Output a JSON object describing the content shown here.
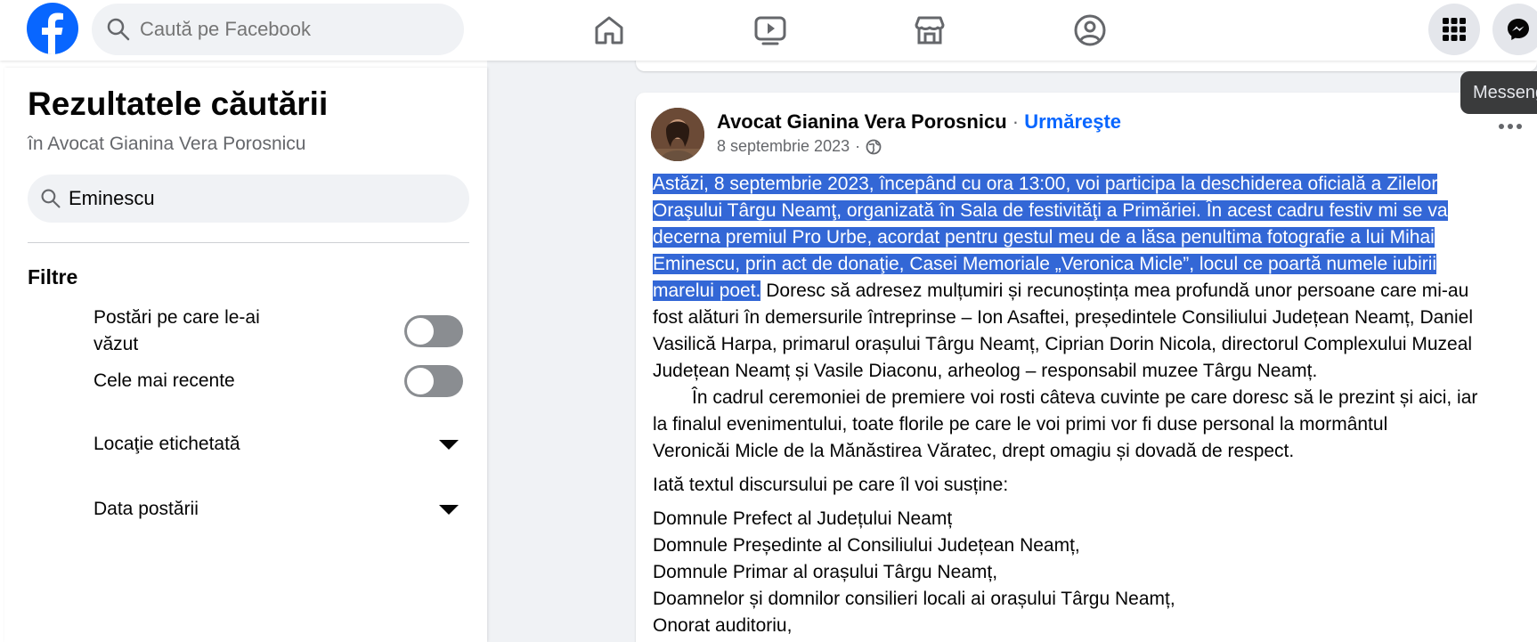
{
  "topbar": {
    "search_placeholder": "Caută pe Facebook",
    "nav": [
      "home-icon",
      "video-icon",
      "marketplace-icon",
      "groups-icon"
    ],
    "tooltip": "Messenger"
  },
  "sidebar": {
    "title": "Rezultatele căutării",
    "subtitle": "în Avocat Gianina Vera Porosnicu",
    "search_value": "Eminescu",
    "filters_heading": "Filtre",
    "filters": {
      "seen_line1": "Postări pe care le-ai",
      "seen_line2": "văzut",
      "recent": "Cele mai recente",
      "location": "Locaţie etichetată",
      "date": "Data postării"
    }
  },
  "post": {
    "author": "Avocat Gianina Vera Porosnicu",
    "separator": " · ",
    "follow_label": "Urmăreşte",
    "date": "8 septembrie 2023",
    "date_separator": "·",
    "lines": {
      "l1": "Astăzi, 8 septembrie 2023, începând cu ora 13:00, voi participa la deschiderea oficială a Zilelor",
      "l2": "Oraşului Târgu Neamţ, organizată în Sala de festivităţi a Primăriei. În acest cadru festiv mi se va",
      "l3": "decerna premiul Pro Urbe, acordat pentru gestul meu de a lăsa penultima fotografie a lui Mihai",
      "l4": "Eminescu, prin act de donaţie, Casei Memoriale „Veronica Micle”, locul ce poartă numele iubirii",
      "l5a": "marelui poet.",
      "l5b": " Doresc să adresez mulțumiri și recunoștința mea profundă unor persoane care mi-au",
      "l6": "fost alături în demersurile întreprinse – Ion Asaftei, președintele Consiliului Județean Neamț, Daniel",
      "l7": "Vasilică Harpa, primarul orașului Târgu Neamț, Ciprian Dorin Nicola, directorul Complexului Muzeal",
      "l8": "Județean Neamț și Vasile Diaconu, arheolog – responsabil muzee Târgu Neamț.",
      "l9": "În cadrul ceremoniei de premiere voi rosti câteva cuvinte pe care doresc să le prezint și aici, iar",
      "l10": "la finalul evenimentului, toate florile pe care le voi primi vor fi duse personal la mormântul",
      "l11": "Veronicăi Micle de la Mănăstirea Văratec, drept omagiu și dovadă de respect.",
      "l12": "Iată textul discursului pe care îl voi susține:",
      "l13": "Domnule Prefect al Județului Neamț",
      "l14": "Domnule Președinte al Consiliului Județean Neamț,",
      "l15": "Domnule Primar al orașului Târgu Neamț,",
      "l16": "Doamnelor și domnilor consilieri locali ai orașului Târgu Neamț,",
      "l17": "Onorat auditoriu,"
    }
  },
  "colors": {
    "brand": "#0866ff",
    "highlight": "#3367d6",
    "feed_bg": "#f0f2f5"
  }
}
